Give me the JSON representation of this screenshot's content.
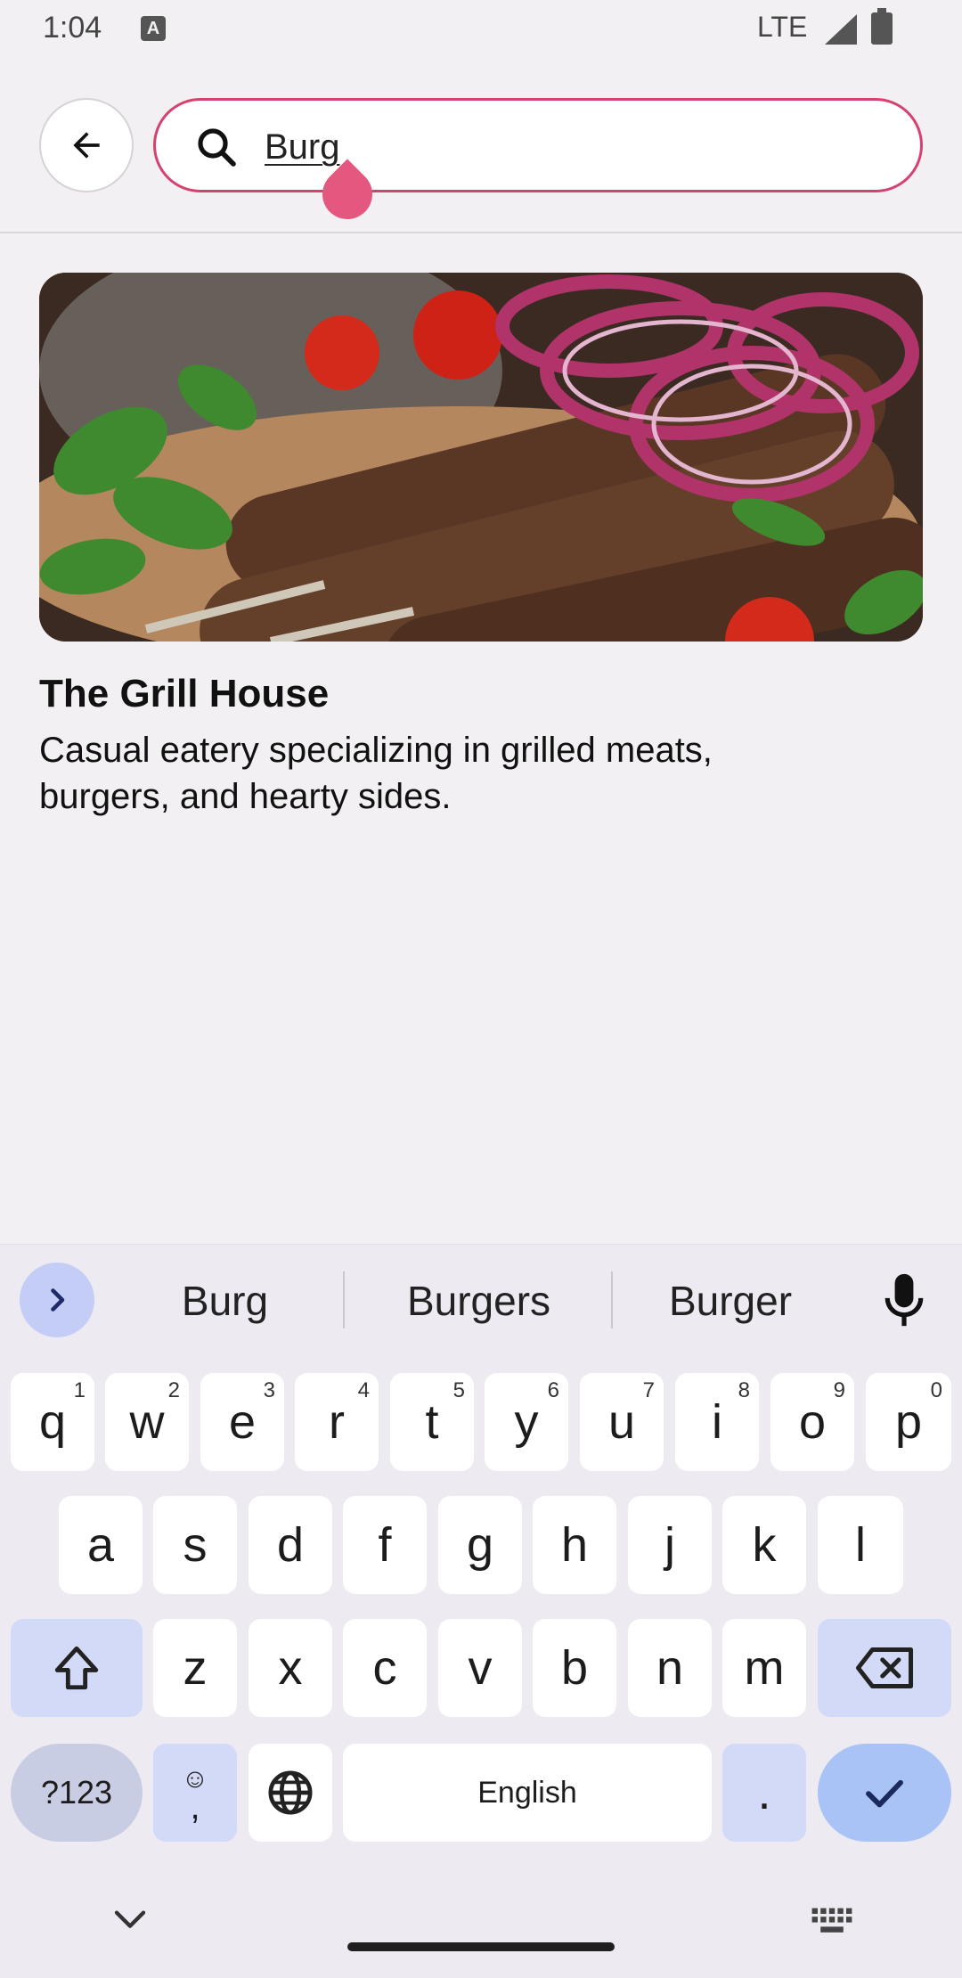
{
  "status_bar": {
    "time": "1:04",
    "notification_icon": "A",
    "network": "LTE"
  },
  "search": {
    "query": "Burg",
    "placeholder": ""
  },
  "result": {
    "title": "The Grill House",
    "description": "Casual eatery specializing in grilled meats, burgers, and hearty sides.",
    "image_desc_icon": "grilled-kebab-photo"
  },
  "keyboard": {
    "suggestions": [
      "Burg",
      "Burgers",
      "Burger"
    ],
    "rows": [
      [
        {
          "k": "q",
          "h": "1"
        },
        {
          "k": "w",
          "h": "2"
        },
        {
          "k": "e",
          "h": "3"
        },
        {
          "k": "r",
          "h": "4"
        },
        {
          "k": "t",
          "h": "5"
        },
        {
          "k": "y",
          "h": "6"
        },
        {
          "k": "u",
          "h": "7"
        },
        {
          "k": "i",
          "h": "8"
        },
        {
          "k": "o",
          "h": "9"
        },
        {
          "k": "p",
          "h": "0"
        }
      ],
      [
        {
          "k": "a"
        },
        {
          "k": "s"
        },
        {
          "k": "d"
        },
        {
          "k": "f"
        },
        {
          "k": "g"
        },
        {
          "k": "h"
        },
        {
          "k": "j"
        },
        {
          "k": "k"
        },
        {
          "k": "l"
        }
      ],
      [
        {
          "k": "z"
        },
        {
          "k": "x"
        },
        {
          "k": "c"
        },
        {
          "k": "v"
        },
        {
          "k": "b"
        },
        {
          "k": "n"
        },
        {
          "k": "m"
        }
      ]
    ],
    "symbols_label": "?123",
    "emoji_label": "☺",
    "comma_label": ",",
    "space_label": "English",
    "period_label": ".",
    "accent_color": "#d6426f"
  }
}
